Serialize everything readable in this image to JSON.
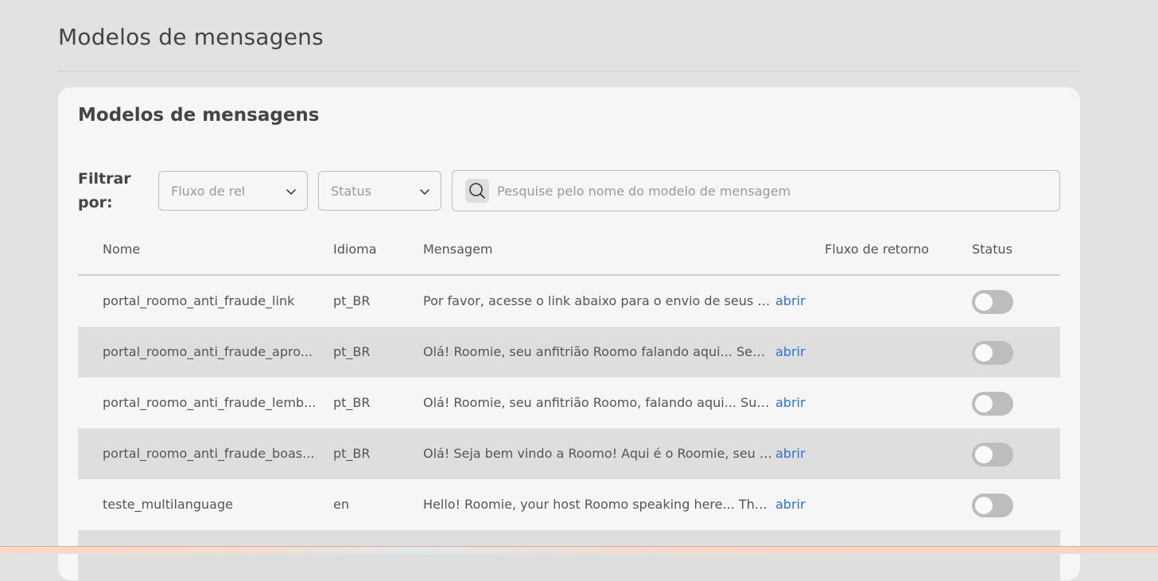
{
  "page": {
    "title": "Modelos de mensagens"
  },
  "card": {
    "title": "Modelos de mensagens",
    "filter_label": "Filtrar por:",
    "flow_select": {
      "value": "Fluxo de ret"
    },
    "status_select": {
      "value": "Status"
    },
    "search": {
      "placeholder": "Pesquise pelo nome do modelo de mensagem",
      "icon": "search-icon"
    }
  },
  "table": {
    "columns": {
      "name": "Nome",
      "language": "Idioma",
      "message": "Mensagem",
      "flow": "Fluxo de retorno",
      "status": "Status"
    },
    "rows": [
      {
        "name": "portal_roomo_anti_fraude_link",
        "language": "pt_BR",
        "message": "Por favor, acesse o link abaixo para o envio de seus doc...",
        "open": "abrir",
        "flow": "",
        "status_on": false
      },
      {
        "name": "portal_roomo_anti_fraude_apro...",
        "language": "pt_BR",
        "message": "Olá! Roomie, seu anfitrião Roomo falando aqui... Seus d...",
        "open": "abrir",
        "flow": "",
        "status_on": false
      },
      {
        "name": "portal_roomo_anti_fraude_lemb...",
        "language": "pt_BR",
        "message": "Olá! Roomie, seu anfitrião Roomo, falando aqui... Sua h...",
        "open": "abrir",
        "flow": "",
        "status_on": false
      },
      {
        "name": "portal_roomo_anti_fraude_boas...",
        "language": "pt_BR",
        "message": "Olá! Seja bem vindo a Roomo! Aqui é o Roomie, seu an...",
        "open": "abrir",
        "flow": "",
        "status_on": false
      },
      {
        "name": "teste_multilanguage",
        "language": "en",
        "message": "Hello! Roomie, your host Roomo speaking here... The li...",
        "open": "abrir",
        "flow": "",
        "status_on": false
      }
    ]
  },
  "colors": {
    "background": "#e2e2e2",
    "card": "#f6f6f6",
    "link": "#2e6fd8",
    "alt_row": "#dedede",
    "toggle_off": "#bdbdbd"
  }
}
